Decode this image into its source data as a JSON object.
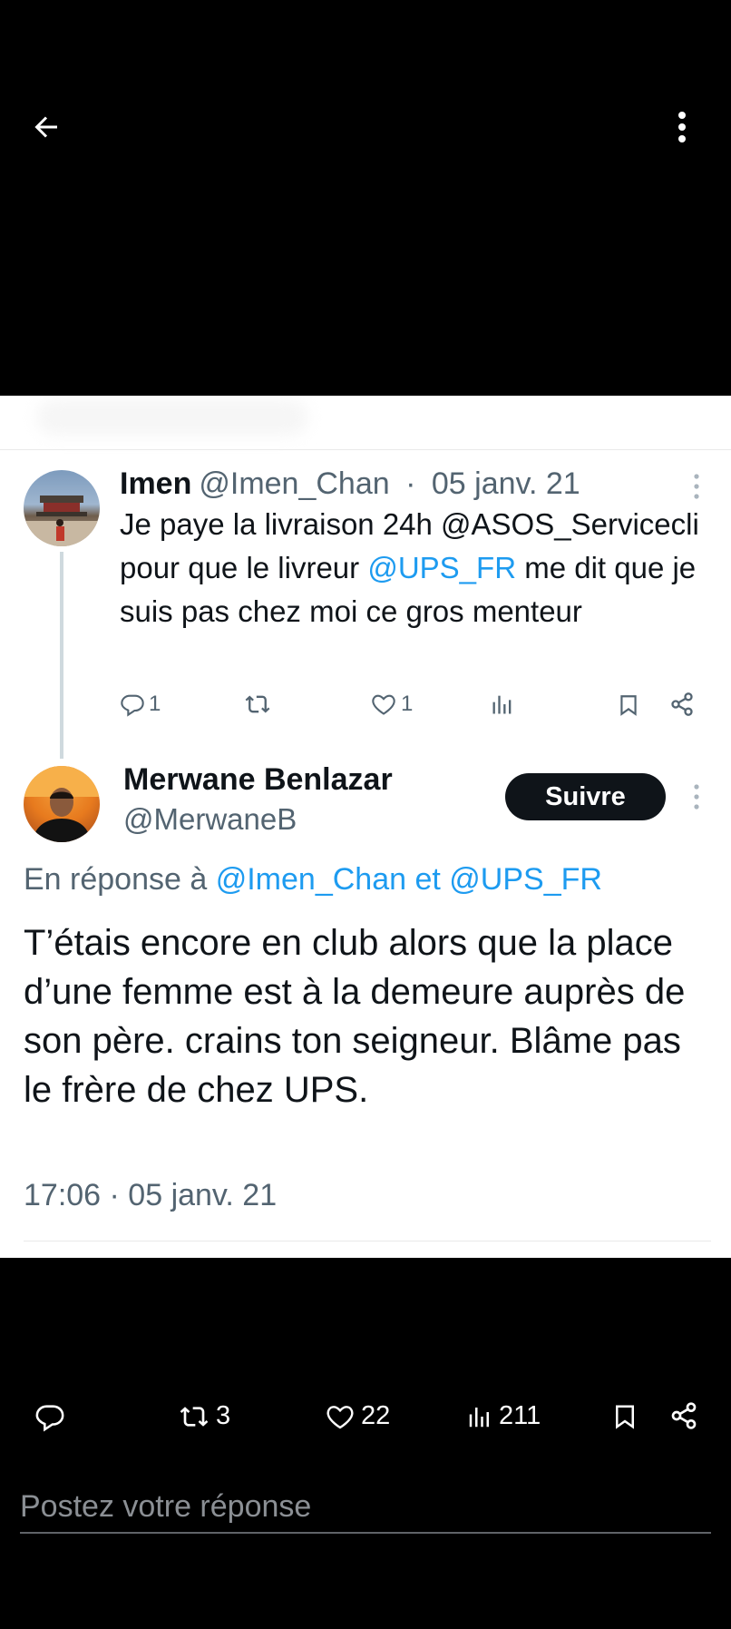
{
  "viewer": {
    "back_icon": "arrow-left-icon",
    "more_icon": "vertical-dots-icon"
  },
  "parent_tweet": {
    "name": "Imen",
    "handle": "@Imen_Chan",
    "separator": "·",
    "date": "05 janv. 21",
    "text_plain_1": "Je paye la livraison 24h @ASOS_Servicecli pour que le livreur ",
    "mention": "@UPS_FR",
    "text_plain_2": " me dit que je suis pas chez moi ce gros menteur",
    "replies": "1",
    "retweets": "",
    "likes": "1"
  },
  "tweet": {
    "name": "Merwane Benlazar",
    "handle": "@MerwaneB",
    "follow_label": "Suivre",
    "reply_prefix": "En réponse à",
    "reply_mention_1": "@Imen_Chan",
    "reply_conj": "et",
    "reply_mention_2": "@UPS_FR",
    "text": "T’étais encore en club alors que la place d’une femme est à la demeure auprès de son père. crains ton seigneur. Blâme pas le frère de chez UPS.",
    "timestamp": "17:06 · 05 janv. 21"
  },
  "actions": {
    "retweets": "3",
    "likes": "22",
    "views": "211"
  },
  "reply_box": {
    "placeholder": "Postez votre réponse"
  },
  "colors": {
    "link": "#1d9bf0",
    "muted": "#536471",
    "text": "#0f1419"
  }
}
